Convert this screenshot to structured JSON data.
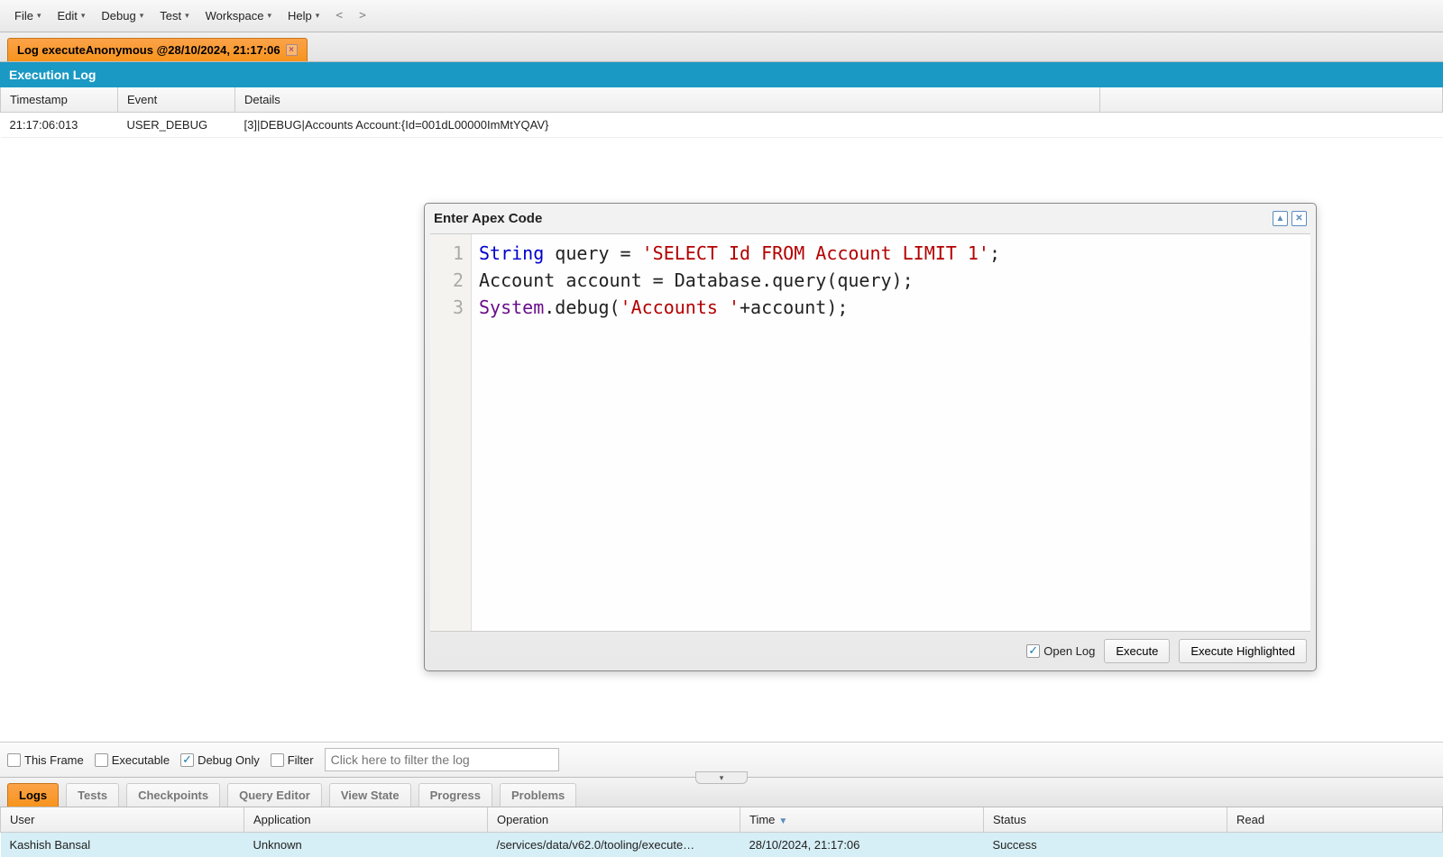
{
  "menu": [
    "File",
    "Edit",
    "Debug",
    "Test",
    "Workspace",
    "Help"
  ],
  "nav": {
    "back": "<",
    "forward": ">"
  },
  "tab": {
    "title": "Log executeAnonymous @28/10/2024, 21:17:06"
  },
  "panel_title": "Execution Log",
  "log_headers": {
    "ts": "Timestamp",
    "ev": "Event",
    "det": "Details"
  },
  "log_row": {
    "ts": "21:17:06:013",
    "ev": "USER_DEBUG",
    "det": "[3]|DEBUG|Accounts Account:{Id=001dL00000ImMtYQAV}"
  },
  "dialog": {
    "title": "Enter Apex Code",
    "lines": [
      {
        "n": "1",
        "tokens": [
          [
            "keyword",
            "String"
          ],
          [
            "plain",
            " query = "
          ],
          [
            "string",
            "'SELECT Id FROM Account LIMIT 1'"
          ],
          [
            "plain",
            ";"
          ]
        ]
      },
      {
        "n": "2",
        "tokens": [
          [
            "plain",
            "Account account = Database.query(query);"
          ]
        ]
      },
      {
        "n": "3",
        "tokens": [
          [
            "type",
            "System"
          ],
          [
            "plain",
            ".debug"
          ],
          [
            "plain",
            "("
          ],
          [
            "string",
            "'Accounts '"
          ],
          [
            "plain",
            "+account"
          ],
          [
            "plain",
            ")"
          ],
          [
            "plain",
            ";"
          ]
        ]
      }
    ],
    "open_log": "Open Log",
    "execute": "Execute",
    "execute_highlighted": "Execute Highlighted"
  },
  "filter_bar": {
    "this_frame": "This Frame",
    "executable": "Executable",
    "debug_only": "Debug Only",
    "filter": "Filter",
    "placeholder": "Click here to filter the log"
  },
  "bottom_tabs": [
    "Logs",
    "Tests",
    "Checkpoints",
    "Query Editor",
    "View State",
    "Progress",
    "Problems"
  ],
  "logs_headers": {
    "user": "User",
    "app": "Application",
    "op": "Operation",
    "time": "Time",
    "status": "Status",
    "read": "Read"
  },
  "logs_row": {
    "user": "Kashish Bansal",
    "app": "Unknown",
    "op": "/services/data/v62.0/tooling/execute…",
    "time": "28/10/2024, 21:17:06",
    "status": "Success",
    "read": ""
  }
}
